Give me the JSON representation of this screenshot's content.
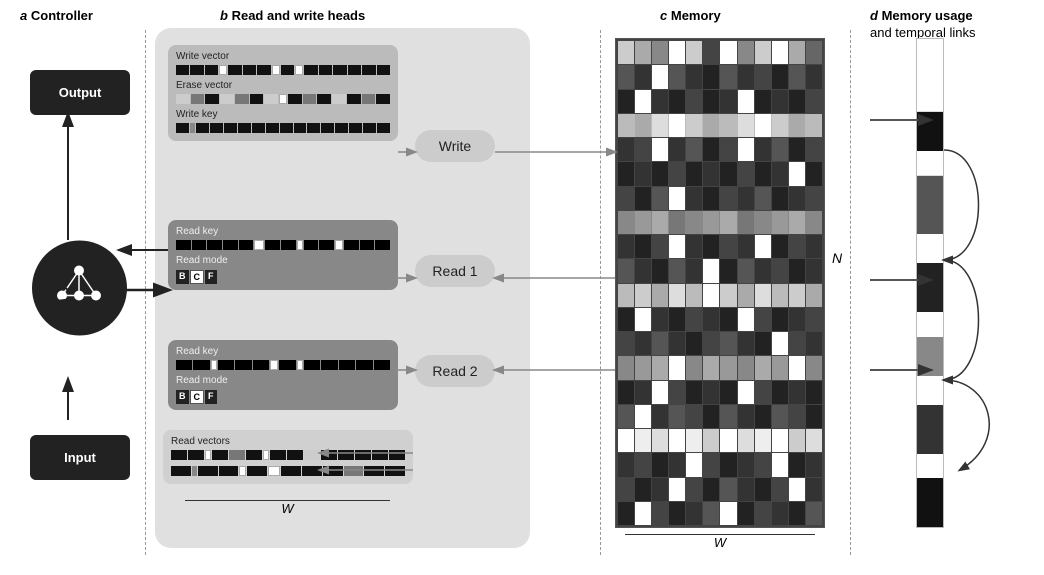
{
  "sections": {
    "a": {
      "letter": "a",
      "title": "Controller"
    },
    "b": {
      "letter": "b",
      "title": "Read and write heads"
    },
    "c": {
      "letter": "c",
      "title": "Memory"
    },
    "d": {
      "letter": "d",
      "title": "Memory usage",
      "subtitle": "and temporal links"
    }
  },
  "controller": {
    "output_label": "Output",
    "input_label": "Input"
  },
  "operations": {
    "write_label": "Write",
    "read1_label": "Read 1",
    "read2_label": "Read 2"
  },
  "panels": {
    "write_vector_label": "Write vector",
    "erase_vector_label": "Erase vector",
    "write_key_label": "Write key",
    "read_key_label": "Read key",
    "read_mode_label": "Read mode",
    "read_vectors_label": "Read vectors"
  },
  "mode_letters": [
    "B",
    "C",
    "F"
  ],
  "labels": {
    "W": "W",
    "N": "N"
  }
}
